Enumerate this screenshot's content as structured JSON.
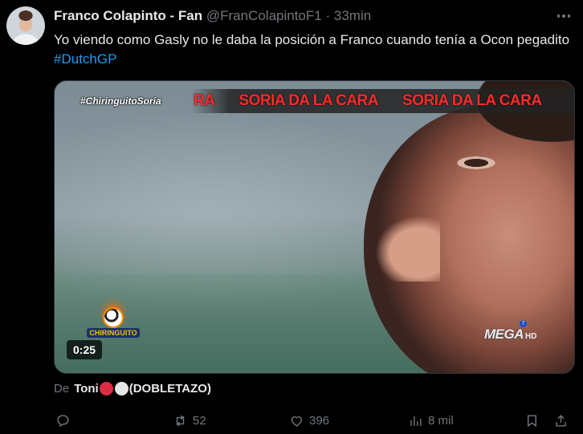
{
  "tweet": {
    "author_name": "Franco Colapinto - Fan",
    "handle": "@FranColapintoF1",
    "separator": "·",
    "time": "33min",
    "text": "Yo viendo como Gasly no le daba la posición a Franco cuando tenía a Ocon pegadito",
    "hashtag": "#DutchGP"
  },
  "media": {
    "banner_tag": "#ChiringuitoSoria",
    "banner_fragment": "RA",
    "banner_text_1": "SORIA DA LA CARA",
    "banner_text_2": "SORIA DA LA CARA",
    "show_logo": "CHIRINGUITO",
    "duration": "0:25",
    "channel_name": "MEGA",
    "channel_hd": "HD",
    "channel_number": "7"
  },
  "attribution": {
    "prefix": "De",
    "user": "Toni",
    "suffix": "(DOBLETAZO)"
  },
  "actions": {
    "reply_icon": "reply-icon",
    "retweet_icon": "retweet-icon",
    "retweets": "52",
    "like_icon": "heart-icon",
    "likes": "396",
    "views_icon": "analytics-icon",
    "views": "8 mil",
    "bookmark_icon": "bookmark-icon",
    "share_icon": "share-icon"
  },
  "colors": {
    "background": "#000000",
    "primary_text": "#e7e9ea",
    "secondary_text": "#71767b",
    "link": "#1d9bf0",
    "banner_red": "#ff2b2b"
  }
}
